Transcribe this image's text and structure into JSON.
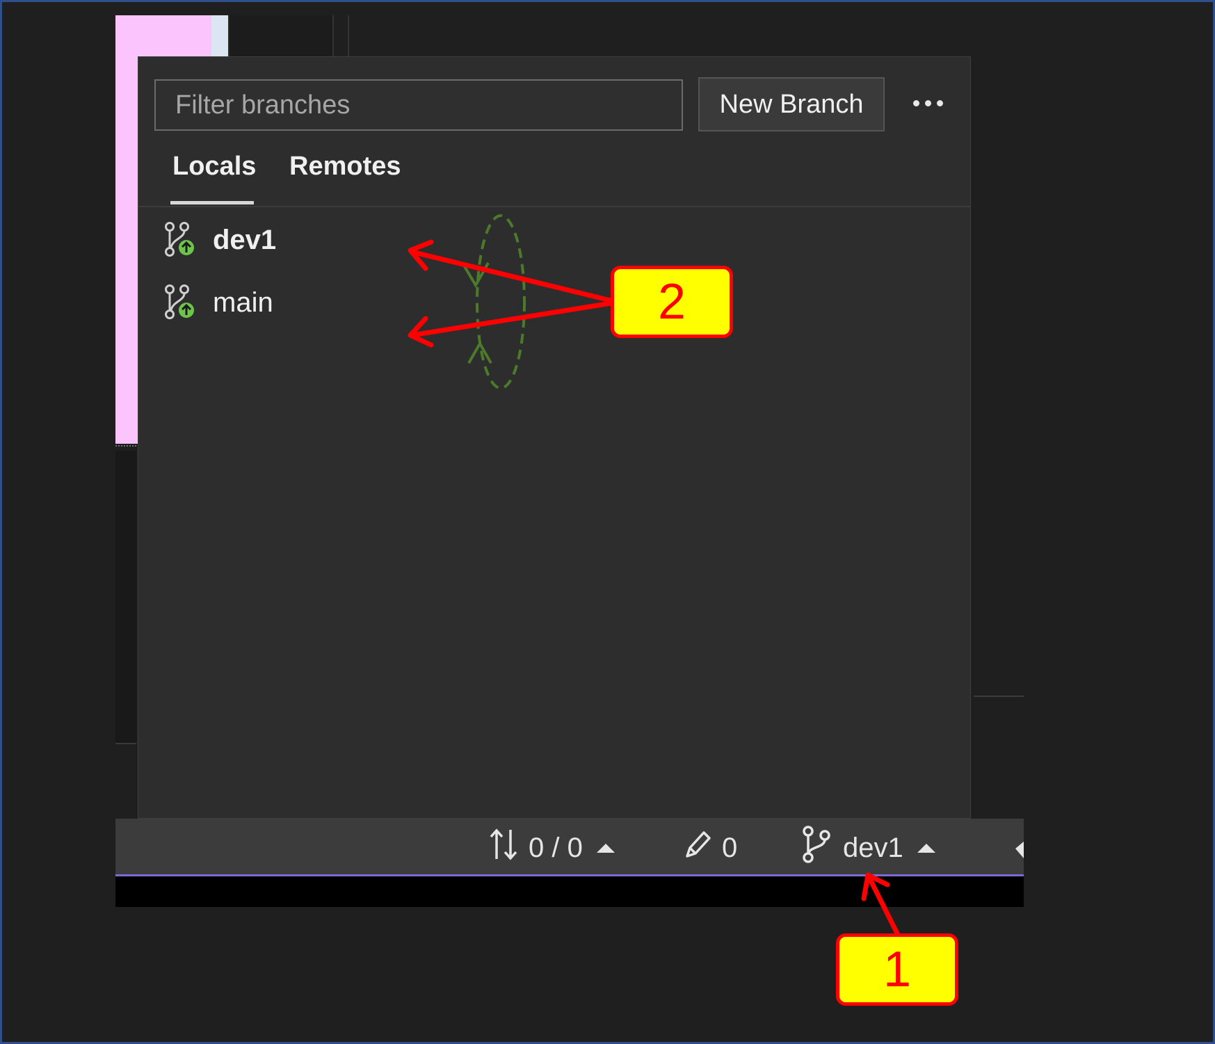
{
  "branch_picker": {
    "filter_placeholder": "Filter branches",
    "new_branch_label": "New Branch",
    "more_icon": "ellipsis-icon",
    "tabs": [
      {
        "label": "Locals",
        "selected": true
      },
      {
        "label": "Remotes",
        "selected": false
      }
    ],
    "branches": [
      {
        "name": "dev1",
        "current": true,
        "icon": "branch-outgoing-icon"
      },
      {
        "name": "main",
        "current": false,
        "icon": "branch-outgoing-icon"
      }
    ]
  },
  "status_bar": {
    "sync_text": "0 / 0",
    "changes_count": "0",
    "branch_name": "dev1"
  },
  "annotations": {
    "callout_1": "1",
    "callout_2": "2"
  },
  "colors": {
    "popup_bg": "#2d2d2d",
    "status_bar_bg": "#3c3c3c",
    "accent": "#7a6bd6",
    "annotation_red": "#ff0000",
    "annotation_yellow": "#ffff00",
    "annotation_green": "#4a7a2a",
    "branch_icon_green": "#6cc44a"
  }
}
